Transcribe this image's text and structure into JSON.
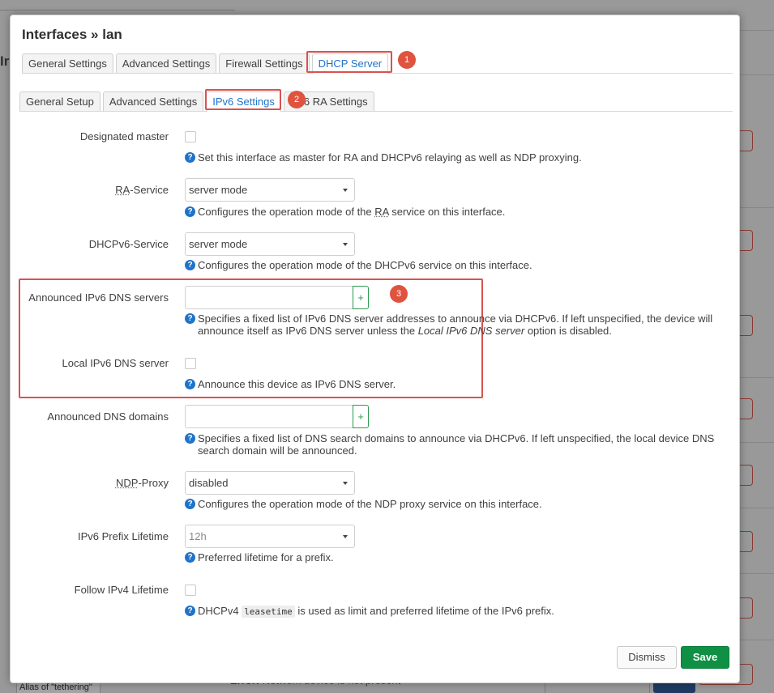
{
  "background": {
    "page_letter": "Ir",
    "alias_text": "Alias of \"tethering\"",
    "error_label": "Error:",
    "error_text": "Network device is not present"
  },
  "modal": {
    "title": "Interfaces » lan",
    "main_tabs": [
      {
        "label": "General Settings"
      },
      {
        "label": "Advanced Settings"
      },
      {
        "label": "Firewall Settings"
      },
      {
        "label": "DHCP Server"
      }
    ],
    "sub_tabs": [
      {
        "label": "General Setup"
      },
      {
        "label": "Advanced Settings"
      },
      {
        "label": "IPv6 Settings"
      },
      {
        "label": "6 RA Settings"
      }
    ],
    "annotations": [
      "1",
      "2",
      "3"
    ],
    "fields": {
      "designated_master": {
        "label": "Designated master",
        "help": "Set this interface as master for RA and DHCPv6 relaying as well as NDP proxying."
      },
      "ra_service": {
        "label_abbr": "RA",
        "label_rest": "-Service",
        "value": "server mode",
        "help_pre": "Configures the operation mode of the ",
        "help_abbr": "RA",
        "help_post": " service on this interface."
      },
      "dhcpv6_service": {
        "label": "DHCPv6-Service",
        "value": "server mode",
        "help": "Configures the operation mode of the DHCPv6 service on this interface."
      },
      "announced_dns_servers": {
        "label": "Announced IPv6 DNS servers",
        "add": "+",
        "help_line1": "Specifies a fixed list of IPv6 DNS server addresses to announce via DHCPv6. If left unspecified, the device will",
        "help_line2_pre": "announce itself as IPv6 DNS server unless the ",
        "help_line2_em": "Local IPv6 DNS server",
        "help_line2_post": " option is disabled."
      },
      "local_dns_server": {
        "label": "Local IPv6 DNS server",
        "help": "Announce this device as IPv6 DNS server."
      },
      "announced_dns_domains": {
        "label": "Announced DNS domains",
        "add": "+",
        "help_line1": "Specifies a fixed list of DNS search domains to announce via DHCPv6. If left unspecified, the local device DNS",
        "help_line2": "search domain will be announced."
      },
      "ndp_proxy": {
        "label_abbr": "NDP",
        "label_rest": "-Proxy",
        "value": "disabled",
        "help": "Configures the operation mode of the NDP proxy service on this interface."
      },
      "prefix_lifetime": {
        "label": "IPv6 Prefix Lifetime",
        "value": "12h",
        "help": "Preferred lifetime for a prefix."
      },
      "follow_ipv4_lifetime": {
        "label": "Follow IPv4 Lifetime",
        "help_pre": "DHCPv4 ",
        "help_code": "leasetime",
        "help_post": " is used as limit and preferred lifetime of the IPv6 prefix."
      }
    },
    "buttons": {
      "dismiss": "Dismiss",
      "save": "Save"
    },
    "colors": {
      "accent": "#1f73c9",
      "highlight": "#d9534f",
      "save": "#0f9045"
    }
  }
}
